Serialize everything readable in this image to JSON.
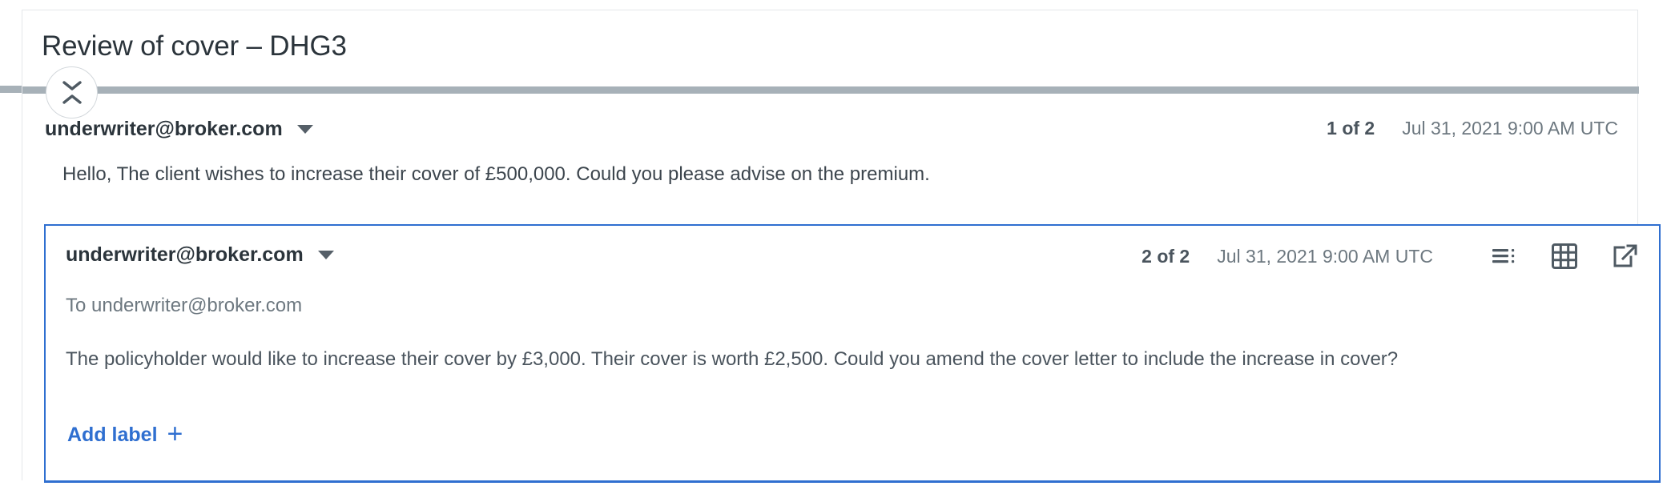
{
  "thread": {
    "title": "Review of cover – DHG3",
    "collapse_button_name": "collapse-expand-toggle"
  },
  "messages": [
    {
      "sender": "underwriter@broker.com",
      "counter": "1 of 2",
      "timestamp": "Jul 31, 2021 9:00 AM UTC",
      "body": "Hello, The client wishes to increase their cover of £500,000. Could you please advise on the premium."
    },
    {
      "sender": "underwriter@broker.com",
      "counter": "2 of 2",
      "timestamp": "Jul 31, 2021 9:00 AM UTC",
      "to": "To underwriter@broker.com",
      "body": "The policyholder would like to increase their cover by £3,000. Their cover is worth £2,500. Could you amend the cover letter to include the increase in cover?",
      "actions": [
        {
          "icon": "list-view-icon"
        },
        {
          "icon": "grid-view-icon"
        },
        {
          "icon": "open-external-icon"
        }
      ]
    }
  ],
  "footer": {
    "add_label": "Add label",
    "add_label_plus": "+"
  },
  "colors": {
    "accent_blue": "#2f6fd0",
    "divider_gray": "#a7b1b8",
    "text_dark": "#2b343b",
    "text_muted": "#6d7880",
    "icon_gray": "#4f5a63"
  }
}
